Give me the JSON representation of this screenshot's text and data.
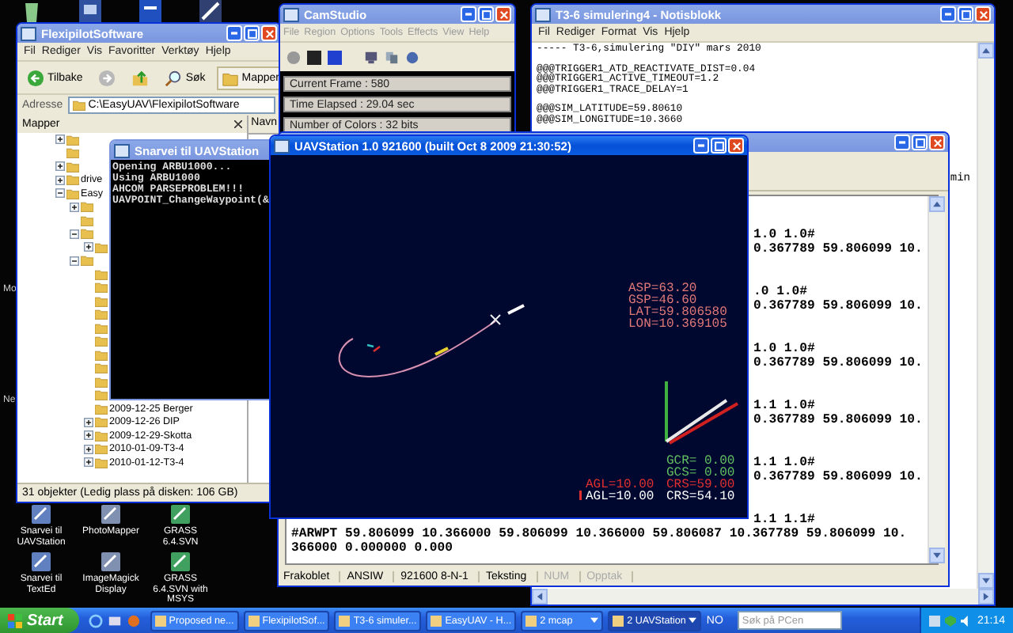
{
  "desktop": {
    "edge_labels": [
      "Mo",
      "Ne"
    ]
  },
  "explorer": {
    "title": "FlexipilotSoftware",
    "active": false,
    "menu": [
      "Fil",
      "Rediger",
      "Vis",
      "Favoritter",
      "Verktøy",
      "Hjelp"
    ],
    "toolbar": [
      {
        "kind": "back",
        "label": "Tilbake"
      },
      {
        "kind": "forward"
      },
      {
        "kind": "up"
      },
      {
        "kind": "search",
        "label": "Søk"
      },
      {
        "kind": "folders",
        "label": "Mapper"
      }
    ],
    "address_label": "Adresse",
    "address": "C:\\EasyUAV\\FlexipilotSoftware",
    "pane_title": "Mapper",
    "column_header": "Navn",
    "tree": [
      {
        "kind": "folder",
        "expanded": false
      },
      {
        "kind": "folder"
      },
      {
        "kind": "folder",
        "expanded": false
      },
      {
        "kind": "folder",
        "label": "drive",
        "expanded": false
      },
      {
        "kind": "folder",
        "label": "Easy",
        "expanded": true,
        "children": [
          {
            "kind": "folder",
            "expanded": false
          },
          {
            "kind": "folder"
          },
          {
            "kind": "folder",
            "expanded": true,
            "children": [
              {
                "kind": "folder",
                "expanded": false
              }
            ]
          },
          {
            "kind": "folder",
            "expanded": true,
            "children": [
              {
                "kind": "folder"
              },
              {
                "kind": "folder"
              },
              {
                "kind": "folder"
              },
              {
                "kind": "folder"
              },
              {
                "kind": "folder"
              },
              {
                "kind": "folder"
              },
              {
                "kind": "folder"
              },
              {
                "kind": "folder"
              },
              {
                "kind": "folder"
              },
              {
                "kind": "folder"
              },
              {
                "kind": "folder",
                "label": "2009-12-25 Berger"
              },
              {
                "kind": "folder",
                "label": "2009-12-26 DIP",
                "expanded": false
              },
              {
                "kind": "folder",
                "label": "2009-12-29-Skotta",
                "expanded": false
              },
              {
                "kind": "folder",
                "label": "2010-01-09-T3-4",
                "expanded": false
              },
              {
                "kind": "folder",
                "label": "2010-01-12-T3-4",
                "expanded": false
              }
            ]
          }
        ]
      }
    ],
    "status": "31 objekter (Ledig plass på disken: 106 GB)"
  },
  "camstudio": {
    "title": "CamStudio",
    "active": false,
    "menu": [
      "File",
      "Region",
      "Options",
      "Tools",
      "Effects",
      "View",
      "Help"
    ],
    "fields": [
      "Current Frame : 580",
      "Time Elapsed : 29.04 sec",
      "Number of Colors : 32 bits"
    ]
  },
  "notepad": {
    "title": "T3-6 simulering4 - Notisblokk",
    "active": false,
    "menu": [
      "Fil",
      "Rediger",
      "Format",
      "Vis",
      "Hjelp"
    ],
    "paragraphs": [
      [
        "----- T3-6,simulering \"DIY\" mars 2010"
      ],
      [
        "@@@TRIGGER1_ATD_REACTIVATE_DIST=0.04",
        "@@@TRIGGER1_ACTIVE_TIMEOUT=1.2",
        "@@@TRIGGER1_TRACE_DELAY=1"
      ],
      [
        "@@@SIM_LATITUDE=59.80610",
        "@@@SIM_LONGITUDE=10.3660"
      ]
    ],
    "fragment": "min"
  },
  "terminal": {
    "active": false,
    "lines": [
      {
        "kind": "clipped",
        "text": "1.0 1.0#"
      },
      {
        "kind": "clipped",
        "text": "0.367789 59.806099 10."
      },
      {
        "kind": "blank"
      },
      {
        "kind": "blank"
      },
      {
        "kind": "clipped",
        "text": ".0 1.0#"
      },
      {
        "kind": "clipped",
        "text": "0.367789 59.806099 10."
      },
      {
        "kind": "blank"
      },
      {
        "kind": "blank"
      },
      {
        "kind": "clipped",
        "text": "1.0 1.0#"
      },
      {
        "kind": "clipped",
        "text": "0.367789 59.806099 10."
      },
      {
        "kind": "blank"
      },
      {
        "kind": "blank"
      },
      {
        "kind": "clipped",
        "text": "1.1 1.0#"
      },
      {
        "kind": "clipped",
        "text": "0.367789 59.806099 10."
      },
      {
        "kind": "blank"
      },
      {
        "kind": "blank"
      },
      {
        "kind": "clipped",
        "text": "1.1 1.0#"
      },
      {
        "kind": "clipped",
        "text": "0.367789 59.806099 10."
      },
      {
        "kind": "blank"
      },
      {
        "kind": "blank"
      },
      {
        "kind": "clipped",
        "text": "1.1 1.1#"
      },
      {
        "kind": "full",
        "text": "#ARWPT 59.806099 10.366000 59.806099 10.366000 59.806087 10.367789 59.806099 10."
      },
      {
        "kind": "full",
        "text": "366000 0.000000 0.000"
      }
    ],
    "status": [
      {
        "label": "Frakoblet",
        "disabled": false
      },
      {
        "label": "ANSIW",
        "disabled": false
      },
      {
        "label": "921600 8-N-1",
        "disabled": false
      },
      {
        "label": "Teksting",
        "disabled": false
      },
      {
        "label": "NUM",
        "disabled": true
      },
      {
        "label": "Opptak",
        "disabled": true
      }
    ]
  },
  "console": {
    "title": "Snarvei til UAVStation",
    "active": false,
    "lines": [
      "Opening ARBU1000...",
      "Using ARBU1000",
      "AHCOM PARSEPROBLEM!!!",
      "UAVPOINT_ChangeWaypoint(&"
    ]
  },
  "uavstation": {
    "title": "UAVStation 1.0 921600 (built Oct  8 2009 21:30:52)",
    "active": true,
    "telemetry": [
      {
        "text": "ASP=63.20",
        "color": "#e07878"
      },
      {
        "text": "GSP=46.60",
        "color": "#e07878"
      },
      {
        "text": "LAT=59.806580",
        "color": "#e07878"
      },
      {
        "text": "LON=10.369105",
        "color": "#e07878"
      }
    ],
    "readouts": [
      {
        "right": {
          "text": "GCR= 0.00",
          "color": "#60c060"
        }
      },
      {
        "right": {
          "text": "GCS= 0.00",
          "color": "#60c060"
        }
      },
      {
        "left": {
          "text": "AGL=10.00",
          "color": "#e03030"
        },
        "right": {
          "text": "CRS=59.00",
          "color": "#e03030"
        }
      },
      {
        "left": {
          "text": "AGL=10.00",
          "color": "#ffffff"
        },
        "right": {
          "text": "CRS=54.10",
          "color": "#ffffff"
        }
      }
    ]
  },
  "desktop_icons": [
    {
      "label": "Snarvei til UAVStation"
    },
    {
      "label": "PhotoMapper"
    },
    {
      "label": "GRASS 6.4.SVN"
    },
    {
      "label": "Snarvei til TextEd"
    },
    {
      "label": "ImageMagick Display"
    },
    {
      "label": "GRASS 6.4.SVN with MSYS"
    }
  ],
  "taskbar": {
    "start": "Start",
    "buttons": [
      {
        "label": "Proposed ne...",
        "selected": false,
        "grouped": false
      },
      {
        "label": "FlexipilotSof...",
        "selected": false,
        "grouped": false
      },
      {
        "label": "T3-6 simuler...",
        "selected": false,
        "grouped": false
      },
      {
        "label": "EasyUAV - H...",
        "selected": false,
        "grouped": false
      },
      {
        "label": "2 mcap",
        "selected": false,
        "grouped": true
      },
      {
        "label": "2 UAVStation",
        "selected": true,
        "grouped": true
      }
    ],
    "language": "NO",
    "search_placeholder": "Søk på PCen",
    "clock": "21:14"
  }
}
